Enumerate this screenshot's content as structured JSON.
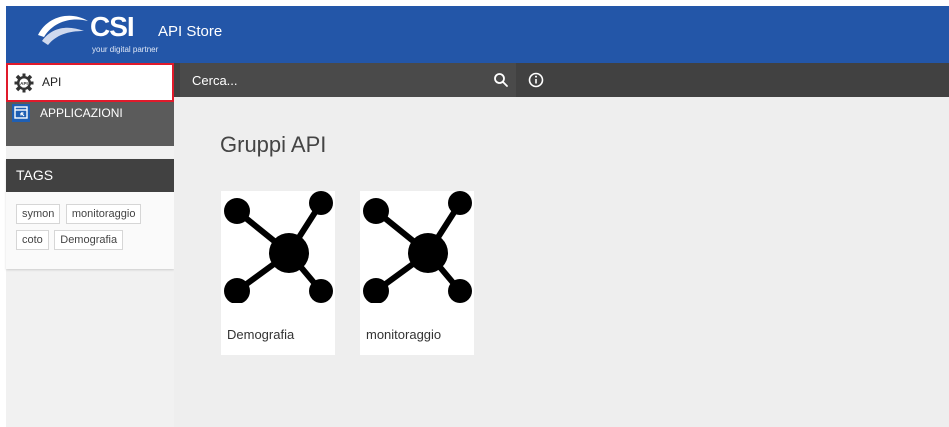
{
  "header": {
    "logo_text": "CSI",
    "logo_tagline": "your digital partner",
    "app_title": "API Store",
    "brand_color": "#2356a8"
  },
  "search": {
    "placeholder": "Cerca...",
    "icon": "search-icon"
  },
  "toolbar": {
    "info_icon": "info-icon"
  },
  "sidebar": {
    "items": [
      {
        "label": "API",
        "icon": "gear-api-icon",
        "selected": true
      },
      {
        "label": "APPLICAZIONI",
        "icon": "app-window-icon",
        "selected": false
      }
    ],
    "tags": {
      "title": "TAGS",
      "items": [
        "symon",
        "monitoraggio",
        "coto",
        "Demografia"
      ]
    }
  },
  "main": {
    "title": "Gruppi API",
    "cards": [
      {
        "label": "Demografia",
        "icon": "network-hub-icon"
      },
      {
        "label": "monitoraggio",
        "icon": "network-hub-icon"
      }
    ]
  },
  "colors": {
    "highlight_border": "#e01a2b",
    "dark_bar": "#414141"
  }
}
